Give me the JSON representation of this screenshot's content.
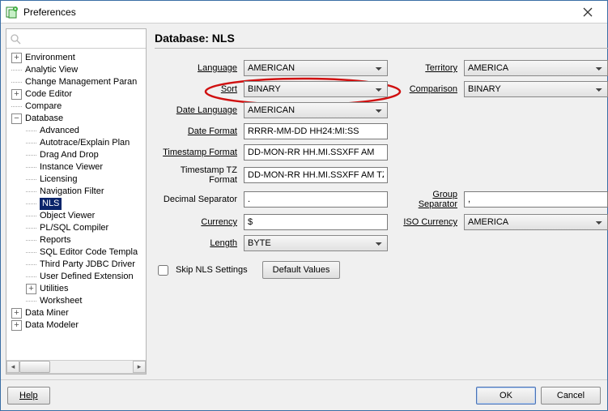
{
  "window": {
    "title": "Preferences"
  },
  "tree": {
    "items": [
      {
        "label": "Environment",
        "toggle": "+",
        "indent": 1
      },
      {
        "label": "Analytic View",
        "toggle": "",
        "indent": 1
      },
      {
        "label": "Change Management Paran",
        "toggle": "",
        "indent": 1
      },
      {
        "label": "Code Editor",
        "toggle": "+",
        "indent": 1
      },
      {
        "label": "Compare",
        "toggle": "",
        "indent": 1
      },
      {
        "label": "Database",
        "toggle": "-",
        "indent": 1
      },
      {
        "label": "Advanced",
        "toggle": "",
        "indent": 2
      },
      {
        "label": "Autotrace/Explain Plan",
        "toggle": "",
        "indent": 2
      },
      {
        "label": "Drag And Drop",
        "toggle": "",
        "indent": 2
      },
      {
        "label": "Instance Viewer",
        "toggle": "",
        "indent": 2
      },
      {
        "label": "Licensing",
        "toggle": "",
        "indent": 2
      },
      {
        "label": "Navigation Filter",
        "toggle": "",
        "indent": 2
      },
      {
        "label": "NLS",
        "toggle": "",
        "indent": 2,
        "selected": true
      },
      {
        "label": "Object Viewer",
        "toggle": "",
        "indent": 2
      },
      {
        "label": "PL/SQL Compiler",
        "toggle": "",
        "indent": 2
      },
      {
        "label": "Reports",
        "toggle": "",
        "indent": 2
      },
      {
        "label": "SQL Editor Code Templa",
        "toggle": "",
        "indent": 2
      },
      {
        "label": "Third Party JDBC Driver",
        "toggle": "",
        "indent": 2
      },
      {
        "label": "User Defined Extension",
        "toggle": "",
        "indent": 2
      },
      {
        "label": "Utilities",
        "toggle": "+",
        "indent": 2
      },
      {
        "label": "Worksheet",
        "toggle": "",
        "indent": 2
      },
      {
        "label": "Data Miner",
        "toggle": "+",
        "indent": 1
      },
      {
        "label": "Data Modeler",
        "toggle": "+",
        "indent": 1
      }
    ]
  },
  "panel": {
    "title": "Database: NLS"
  },
  "form": {
    "language": {
      "label": "Language",
      "value": "AMERICAN"
    },
    "territory": {
      "label": "Territory",
      "value": "AMERICA"
    },
    "sort": {
      "label": "Sort",
      "value": "BINARY"
    },
    "comparison": {
      "label": "Comparison",
      "value": "BINARY"
    },
    "date_language": {
      "label": "Date Language",
      "value": "AMERICAN"
    },
    "date_format": {
      "label": "Date Format",
      "value": "RRRR-MM-DD HH24:MI:SS"
    },
    "timestamp_format": {
      "label": "Timestamp Format",
      "value": "DD-MON-RR HH.MI.SSXFF AM"
    },
    "timestamp_tz_format": {
      "label": "Timestamp TZ Format",
      "value": "DD-MON-RR HH.MI.SSXFF AM TZR"
    },
    "decimal_separator": {
      "label": "Decimal Separator",
      "value": "."
    },
    "group_separator": {
      "label": "Group Separator",
      "value": ","
    },
    "currency": {
      "label": "Currency",
      "value": "$"
    },
    "iso_currency": {
      "label": "ISO Currency",
      "value": "AMERICA"
    },
    "length": {
      "label": "Length",
      "value": "BYTE"
    },
    "skip_label": "Skip NLS Settings",
    "default_values_label": "Default Values"
  },
  "footer": {
    "help": "Help",
    "ok": "OK",
    "cancel": "Cancel"
  }
}
